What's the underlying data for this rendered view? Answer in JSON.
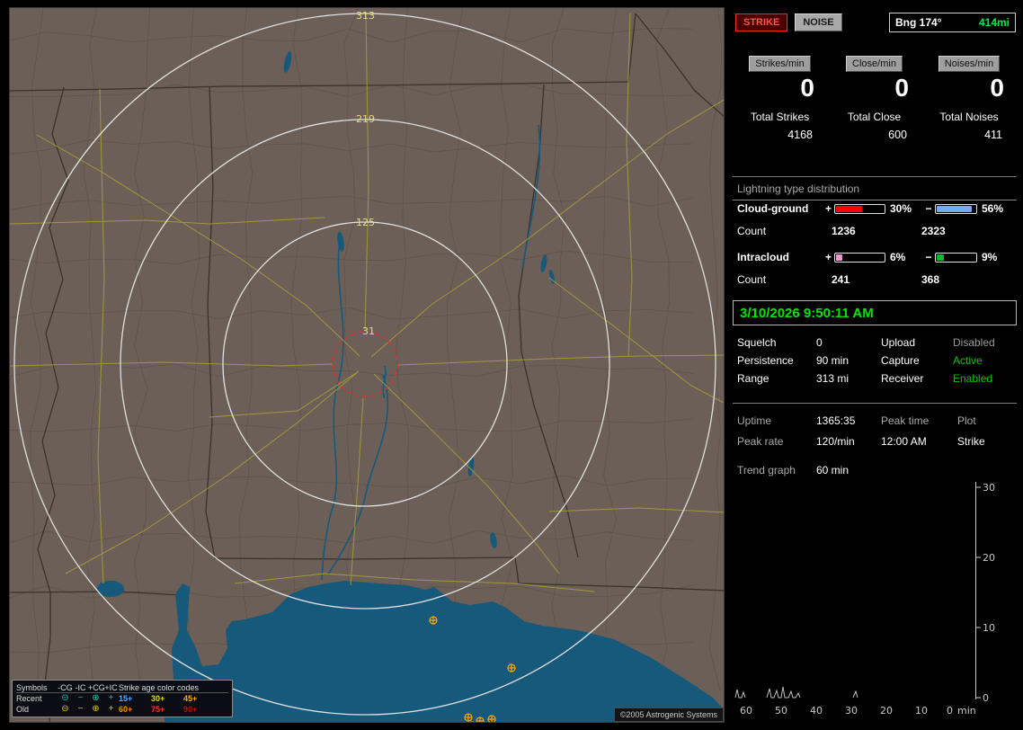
{
  "top": {
    "strike_button": "STRIKE",
    "noise_button": "NOISE",
    "bearing_label": "Bng 174°",
    "bearing_value": "414mi"
  },
  "rates": [
    {
      "button": "Strikes/min",
      "value": "0",
      "total_label": "Total Strikes",
      "total_value": "4168"
    },
    {
      "button": "Close/min",
      "value": "0",
      "total_label": "Total Close",
      "total_value": "600"
    },
    {
      "button": "Noises/min",
      "value": "0",
      "total_label": "Total Noises",
      "total_value": "411"
    }
  ],
  "distribution": {
    "title": "Lightning type distribution",
    "rows": [
      {
        "label": "Cloud-ground",
        "pos_sign": "+",
        "pos_pct": "30%",
        "pos_fill": "52%",
        "pos_color": "#ff0000",
        "neg_sign": "−",
        "neg_pct": "56%",
        "neg_fill": "86%",
        "neg_color": "#77aaee",
        "count_label": "Count",
        "pos_count": "1236",
        "neg_count": "2323"
      },
      {
        "label": "Intracloud",
        "pos_sign": "+",
        "pos_pct": "6%",
        "pos_fill": "13%",
        "pos_color": "#ee99cc",
        "neg_sign": "−",
        "neg_pct": "9%",
        "neg_fill": "18%",
        "neg_color": "#00bb33",
        "count_label": "Count",
        "pos_count": "241",
        "neg_count": "368"
      }
    ]
  },
  "datetime": "3/10/2026 9:50:11 AM",
  "status_rows": [
    {
      "l1": "Squelch",
      "v1": "0",
      "l2": "Upload",
      "v2": "Disabled",
      "v2_color": "#9a9a9a"
    },
    {
      "l1": "Persistence",
      "v1": "90 min",
      "l2": "Capture",
      "v2": "Active",
      "v2_color": "#00cc00"
    },
    {
      "l1": "Range",
      "v1": "313 mi",
      "l2": "Receiver",
      "v2": "Enabled",
      "v2_color": "#00cc00"
    }
  ],
  "stats": {
    "uptime_label": "Uptime",
    "uptime_value": "1365:35",
    "peak_time_label": "Peak time",
    "plot_label": "Plot",
    "peak_rate_label": "Peak rate",
    "peak_rate_value": "120/min",
    "peak_time_value": "12:00 AM",
    "plot_value": "Strike"
  },
  "trend": {
    "label": "Trend graph",
    "window": "60 min",
    "y_ticks": [
      "30",
      "20",
      "10",
      "0"
    ],
    "x_ticks": [
      "60",
      "50",
      "40",
      "30",
      "20",
      "10",
      "0",
      "min"
    ]
  },
  "map": {
    "ring_labels": [
      "313",
      "219",
      "125",
      "31"
    ],
    "copyright": "©2005 Astrogenic Systems",
    "legend": {
      "symbols_title": "Symbols",
      "columns": [
        "-CG",
        "-IC",
        "+CG",
        "+IC"
      ],
      "age_title": "Strike age color codes",
      "rows": [
        {
          "label": "Recent",
          "glyphs": [
            "⊖",
            "−",
            "⊕",
            "+"
          ],
          "glyph_color": "#00c8a8",
          "ages": [
            {
              "text": "15+",
              "color": "#55aaff"
            },
            {
              "text": "30+",
              "color": "#dddd00"
            },
            {
              "text": "45+",
              "color": "#ffaa00"
            }
          ]
        },
        {
          "label": "Old",
          "glyphs": [
            "⊖",
            "−",
            "⊕",
            "+"
          ],
          "glyph_color": "#d8cc00",
          "ages": [
            {
              "text": "60+",
              "color": "#ff8800"
            },
            {
              "text": "75+",
              "color": "#ff3322"
            },
            {
              "text": "90+",
              "color": "#bb1100"
            }
          ]
        }
      ]
    }
  }
}
